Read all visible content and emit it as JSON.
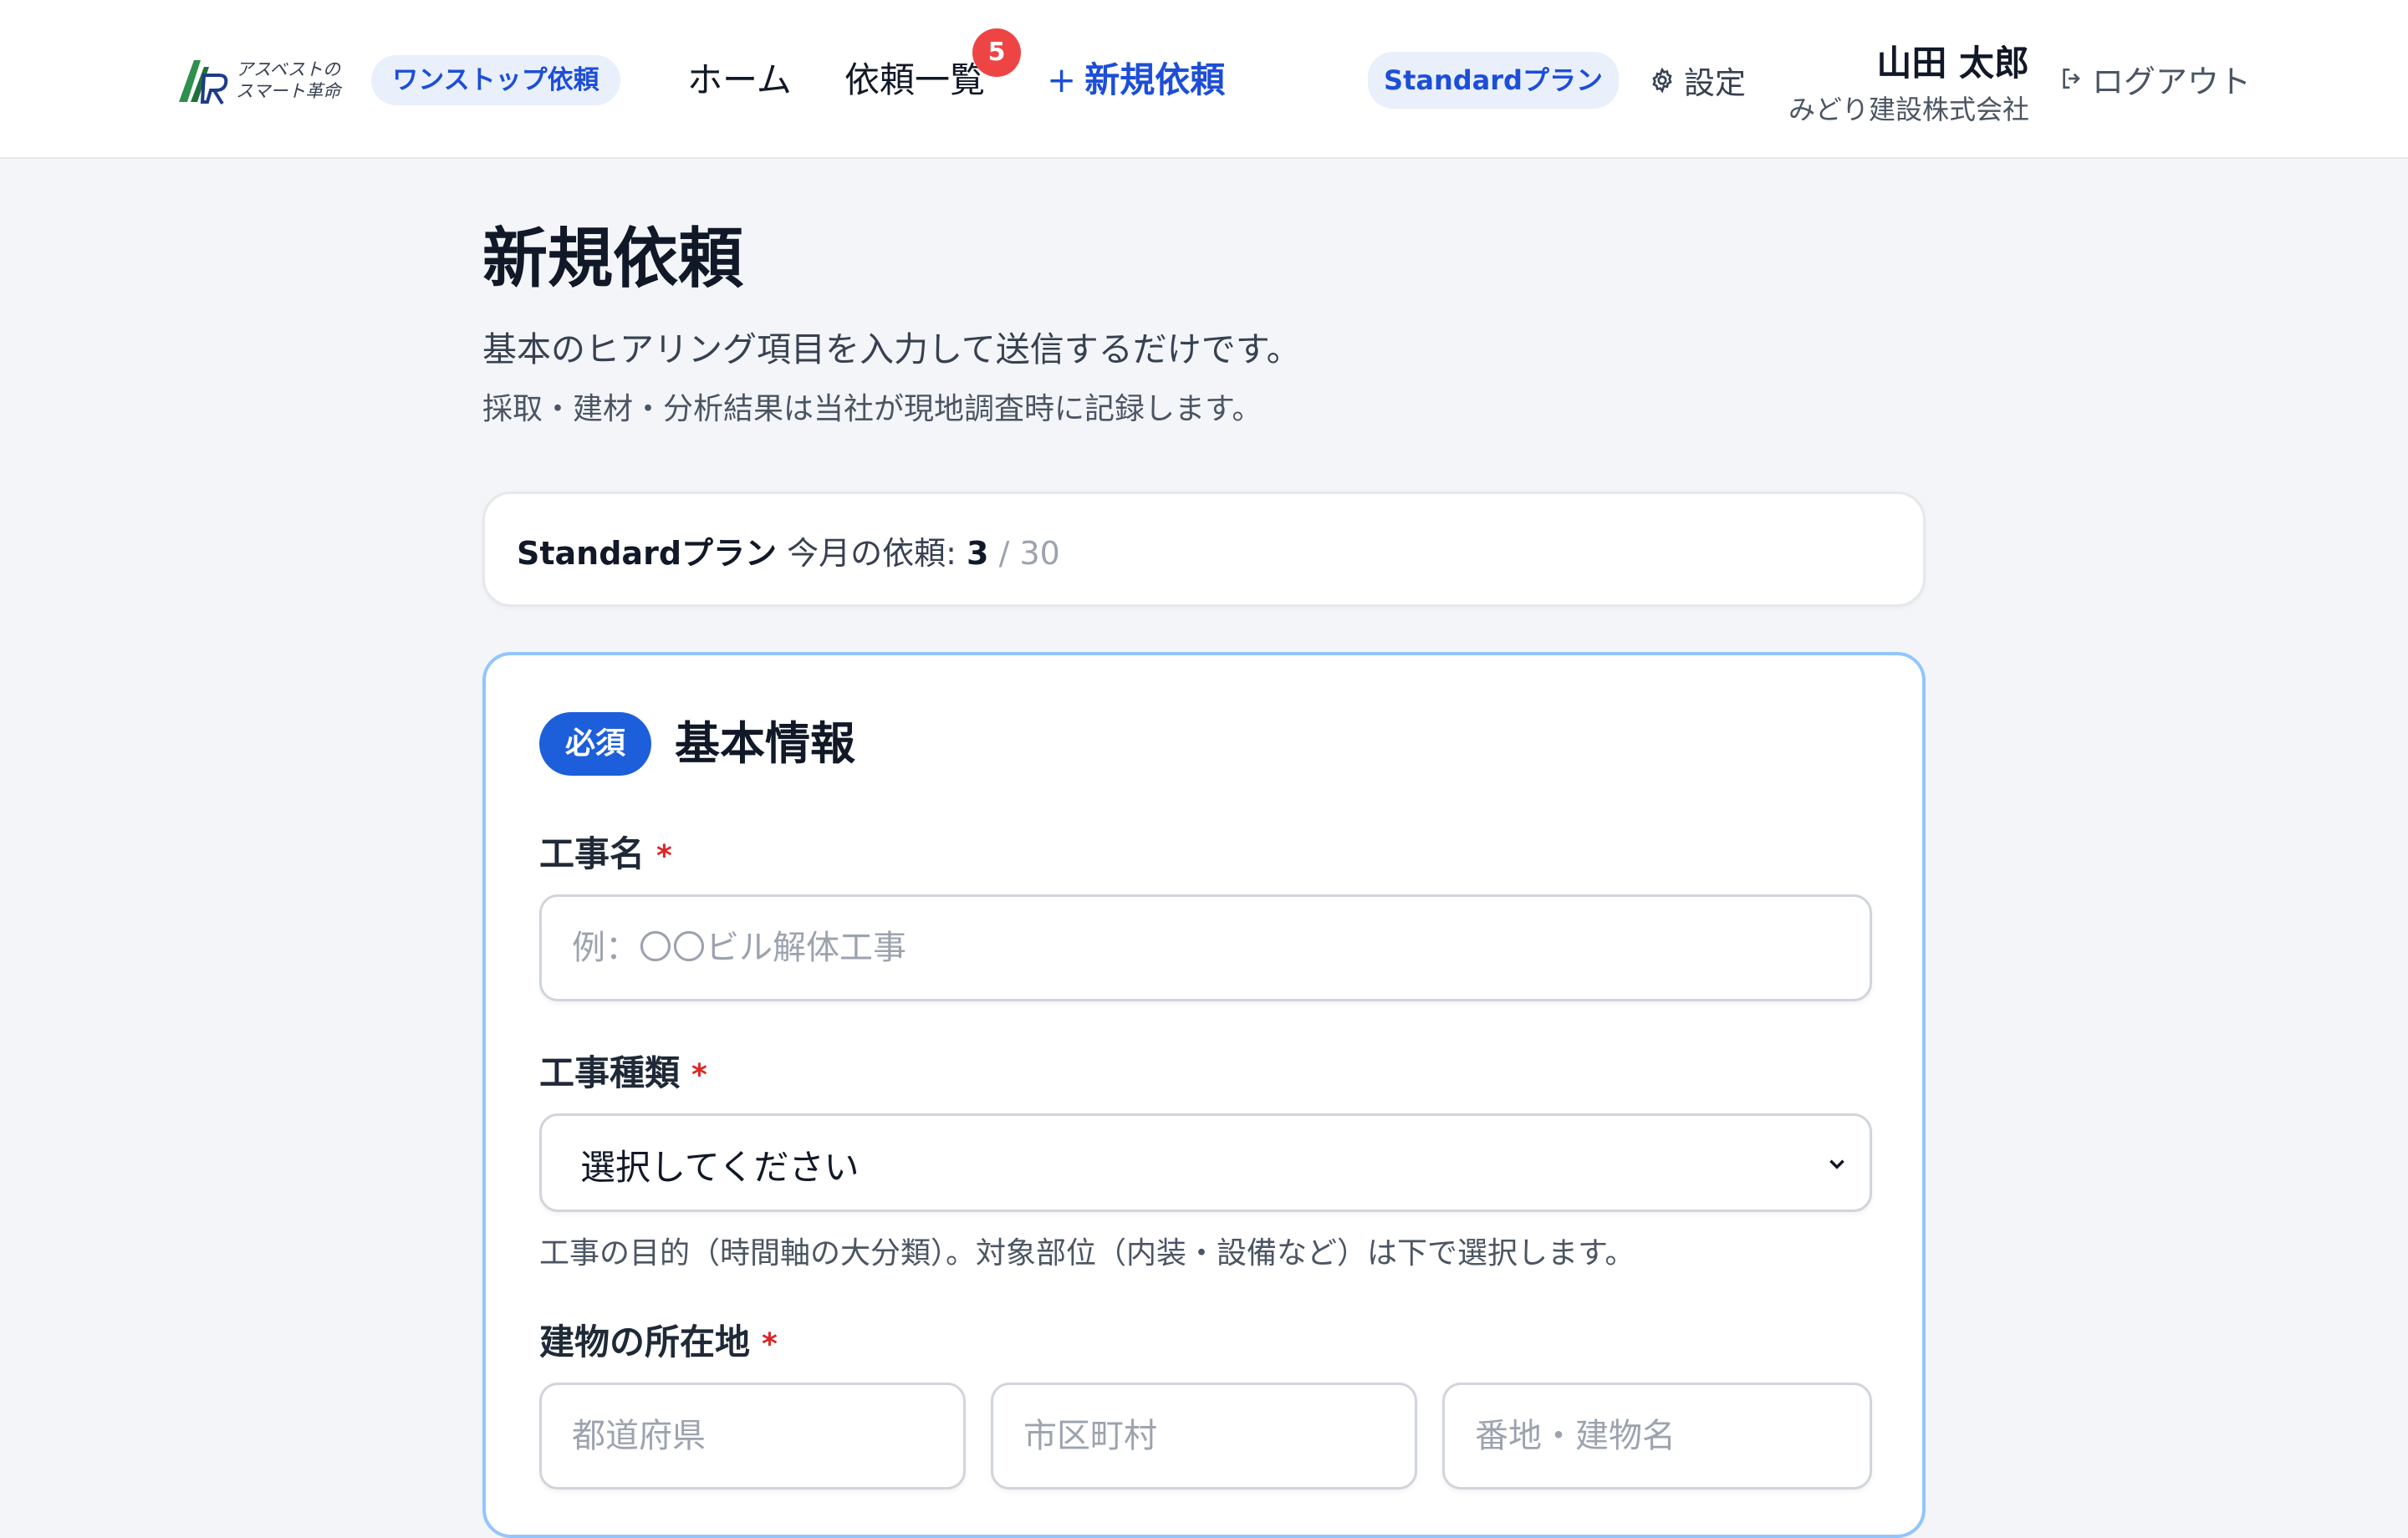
{
  "header": {
    "logo_line1": "アスベストの",
    "logo_line2": "スマート革命",
    "onestop_label": "ワンストップ依頼",
    "nav": {
      "home": "ホーム",
      "requests": "依頼一覧",
      "requests_badge": "5",
      "new_plus": "+",
      "new_request": "新規依頼"
    },
    "plan_badge": "Standardプラン",
    "settings_label": "設定",
    "user_name": "山田 太郎",
    "company": "みどり建設株式会社",
    "logout_label": "ログアウト",
    "icons": {
      "logo": "company-logo",
      "settings": "gear-icon",
      "logout": "logout-icon"
    }
  },
  "page": {
    "title": "新規依頼",
    "lead": "基本のヒアリング項目を入力して送信するだけです。",
    "sub": "採取・建材・分析結果は当社が現地調査時に記録します。"
  },
  "quota": {
    "plan": "Standardプラン",
    "label": "今月の依頼:",
    "used": "3",
    "separator": "/",
    "total": "30"
  },
  "form": {
    "required_badge": "必須",
    "section_title": "基本情報",
    "required_mark": "*",
    "fields": {
      "project_name": {
        "label": "工事名",
        "value": "",
        "placeholder": "例：〇〇ビル解体工事"
      },
      "work_type": {
        "label": "工事種類",
        "selected": "選択してください",
        "help": "工事の目的（時間軸の大分類）。対象部位（内装・設備など）は下で選択します。"
      },
      "address": {
        "label": "建物の所在地",
        "prefecture_placeholder": "都道府県",
        "city_placeholder": "市区町村",
        "street_placeholder": "番地・建物名"
      }
    }
  },
  "colors": {
    "accent": "#1d4ed8",
    "badge_red": "#ef4444",
    "required_red": "#dc2626",
    "card_border_focus": "#93c5fd",
    "background": "#f3f5f9"
  }
}
